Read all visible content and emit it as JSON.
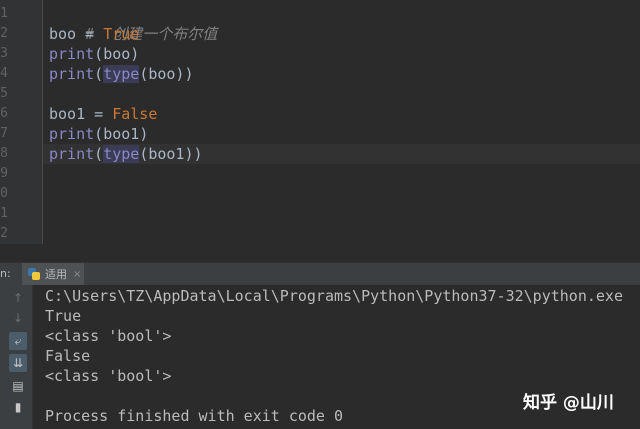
{
  "editor": {
    "line_numbers": [
      "1",
      "2",
      "3",
      "4",
      "5",
      "6",
      "7",
      "8",
      "9",
      "0",
      "1",
      "2"
    ],
    "lines": [
      {
        "comment": "#  创建一个布尔值"
      },
      {
        "name": "boo",
        "op": " = ",
        "value": "True"
      },
      {
        "fn": "print",
        "open": "(",
        "arg": "boo",
        "close": ")"
      },
      {
        "fn": "print",
        "open": "(",
        "type": "type",
        "arg": "(boo)",
        "close": ")"
      },
      {},
      {
        "name": "boo1",
        "op": " = ",
        "value": "False"
      },
      {
        "fn": "print",
        "open": "(",
        "arg": "boo1",
        "close": ")"
      },
      {
        "fn": "print",
        "open": "(",
        "type": "type",
        "arg": "(boo1)",
        "close": ")"
      }
    ]
  },
  "run_panel": {
    "label": "n:",
    "tab_title": "适用",
    "tab_close": "×",
    "toolbar_icons": [
      "up-arrow-icon",
      "down-arrow-icon",
      "soft-wrap-icon",
      "scroll-to-end-icon",
      "print-icon",
      "trash-icon"
    ],
    "console": [
      "C:\\Users\\TZ\\AppData\\Local\\Programs\\Python\\Python37-32\\python.exe",
      "True",
      "<class 'bool'>",
      "False",
      "<class 'bool'>",
      "",
      "Process finished with exit code 0"
    ]
  },
  "watermark": "知乎 @山川",
  "colors": {
    "background": "#2b2b2b",
    "gutter": "#313335",
    "keyword": "#cc7832",
    "builtin": "#8888c6",
    "text": "#a9b7c6"
  }
}
